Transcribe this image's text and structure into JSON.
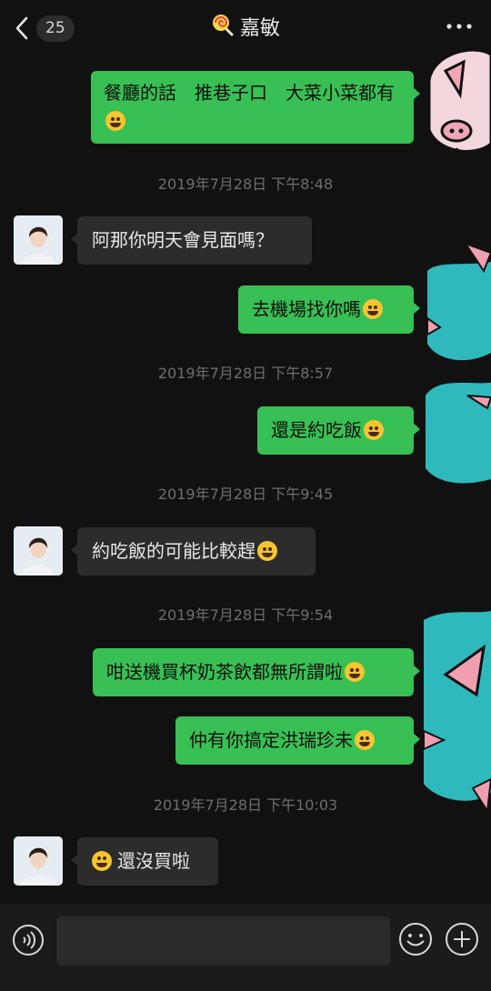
{
  "header": {
    "back_count": "25",
    "title": "嘉敏",
    "back_icon": "chevron-left-icon",
    "more_icon": "more-dots-icon"
  },
  "messages": [
    {
      "side": "out",
      "text": "餐廳的話　推巷子口　大菜小菜都有",
      "emoji": "smiling-face-hearts"
    },
    {
      "side": "in",
      "text": "阿那你明天會見面嗎？"
    },
    {
      "side": "out",
      "text": "去機場找你嗎",
      "emoji": "thinking-face"
    },
    {
      "side": "out",
      "text": "還是約吃飯",
      "emoji": "thinking-face"
    },
    {
      "side": "in",
      "text": "約吃飯的可能比較趕",
      "emoji": "crying-face"
    },
    {
      "side": "out",
      "text": "咁送機買杯奶茶飲都無所謂啦",
      "emoji": "winking-tongue-face"
    },
    {
      "side": "out",
      "text": "仲有你搞定洪瑞珍未",
      "emoji": "woozy-face"
    },
    {
      "side": "in",
      "text": "還沒買啦",
      "emoji": "grinning-face",
      "emoji_first": true
    }
  ],
  "timestamps": [
    "2019年7月28日 下午8:48",
    "2019年7月28日 下午8:57",
    "2019年7月28日 下午9:45",
    "2019年7月28日 下午9:54",
    "2019年7月28日 下午10:03"
  ],
  "input": {
    "value": "",
    "placeholder": ""
  },
  "colors": {
    "background": "#111111",
    "outgoing": "#38c054",
    "incoming": "#2c2c2c",
    "sticker": "#2fb9bd"
  }
}
